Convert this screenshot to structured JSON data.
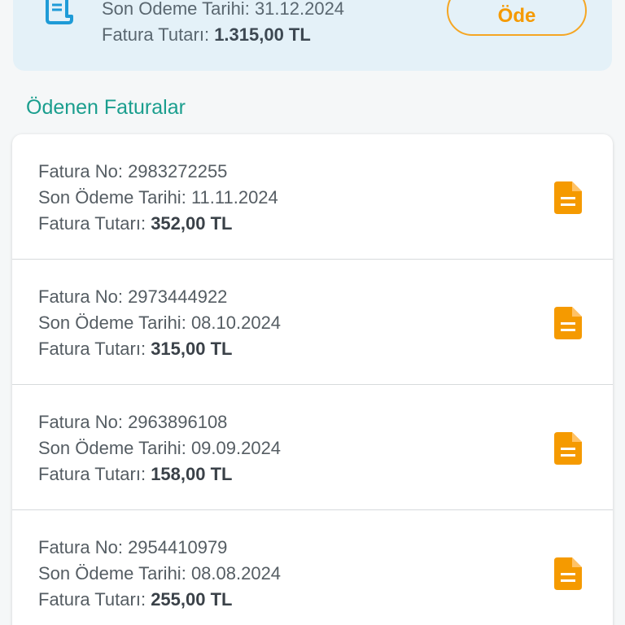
{
  "unpaid": {
    "due_label": "Son Odeme Tarihi:",
    "due_value": "31.12.2024",
    "amount_label": "Fatura Tutarı:",
    "amount_value": "1.315,00 TL",
    "pay_label": "Öde",
    "icon": "receipt-icon"
  },
  "paid_section": {
    "title": "Ödenen Faturalar",
    "items": [
      {
        "no_label": "Fatura No:",
        "no_value": "2983272255",
        "due_label": "Son Ödeme Tarihi:",
        "due_value": "11.11.2024",
        "amount_label": "Fatura Tutarı:",
        "amount_value": "352,00 TL",
        "icon": "document-icon"
      },
      {
        "no_label": "Fatura No:",
        "no_value": "2973444922",
        "due_label": "Son Ödeme Tarihi:",
        "due_value": "08.10.2024",
        "amount_label": "Fatura Tutarı:",
        "amount_value": "315,00 TL",
        "icon": "document-icon"
      },
      {
        "no_label": "Fatura No:",
        "no_value": "2963896108",
        "due_label": "Son Ödeme Tarihi:",
        "due_value": "09.09.2024",
        "amount_label": "Fatura Tutarı:",
        "amount_value": "158,00 TL",
        "icon": "document-icon"
      },
      {
        "no_label": "Fatura No:",
        "no_value": "2954410979",
        "due_label": "Son Ödeme Tarihi:",
        "due_value": "08.08.2024",
        "amount_label": "Fatura Tutarı:",
        "amount_value": "255,00 TL",
        "icon": "document-icon"
      }
    ]
  },
  "colors": {
    "accent_green": "#1a9e8e",
    "accent_orange": "#f59a00",
    "icon_blue": "#1e9bd7",
    "card_bg": "#e4f1f8"
  }
}
